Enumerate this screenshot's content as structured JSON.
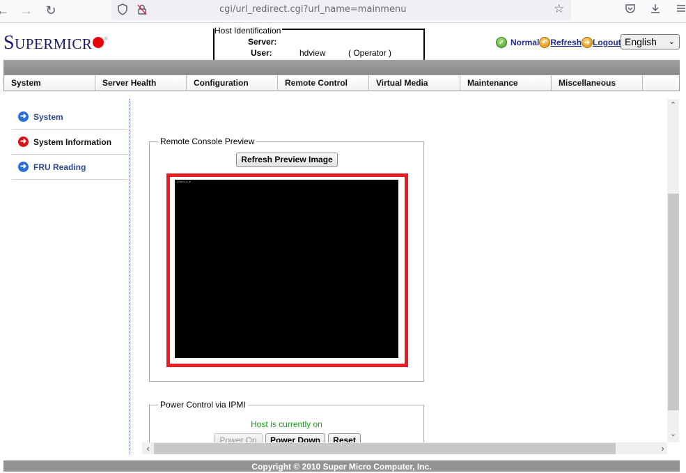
{
  "browser": {
    "url": "cgi/url_redirect.cgi?url_name=mainmenu",
    "icons": [
      "back-icon",
      "forward-icon",
      "reload-icon",
      "shield-icon",
      "insecure-lock-icon",
      "bookmark-star-icon",
      "pocket-icon",
      "download-icon",
      "menu-icon"
    ]
  },
  "header": {
    "logo_big": "S",
    "logo_rest": "UPERMICR",
    "host_identification": {
      "legend": "Host Identification",
      "server_label": "Server:",
      "server_value": "",
      "user_label": "User:",
      "user_value": "hdview",
      "user_role": "( Operator )"
    },
    "status": {
      "normal_label": "Normal",
      "refresh_label": "Refresh",
      "logout_label": "Logout"
    },
    "language": {
      "selected": "English"
    }
  },
  "menu": {
    "items": [
      {
        "label": "System"
      },
      {
        "label": "Server Health"
      },
      {
        "label": "Configuration"
      },
      {
        "label": "Remote Control"
      },
      {
        "label": "Virtual Media"
      },
      {
        "label": "Maintenance"
      },
      {
        "label": "Miscellaneous"
      }
    ]
  },
  "sidebar": {
    "items": [
      {
        "label": "System",
        "active": false
      },
      {
        "label": "System Information",
        "active": true
      },
      {
        "label": "FRU Reading",
        "active": false
      }
    ]
  },
  "preview": {
    "legend": "Remote Console Preview",
    "refresh_button": "Refresh Preview Image",
    "console_text": "root@host:~# _",
    "highlight_color": "#ec1c24"
  },
  "power": {
    "legend": "Power Control via IPMI",
    "status": "Host is currently on",
    "status_color": "#1a9a1a",
    "buttons": {
      "power_on": "Power On",
      "power_down": "Power Down",
      "reset": "Reset"
    }
  },
  "footer": {
    "copyright": "Copyright © 2010 Super Micro Computer, Inc."
  }
}
